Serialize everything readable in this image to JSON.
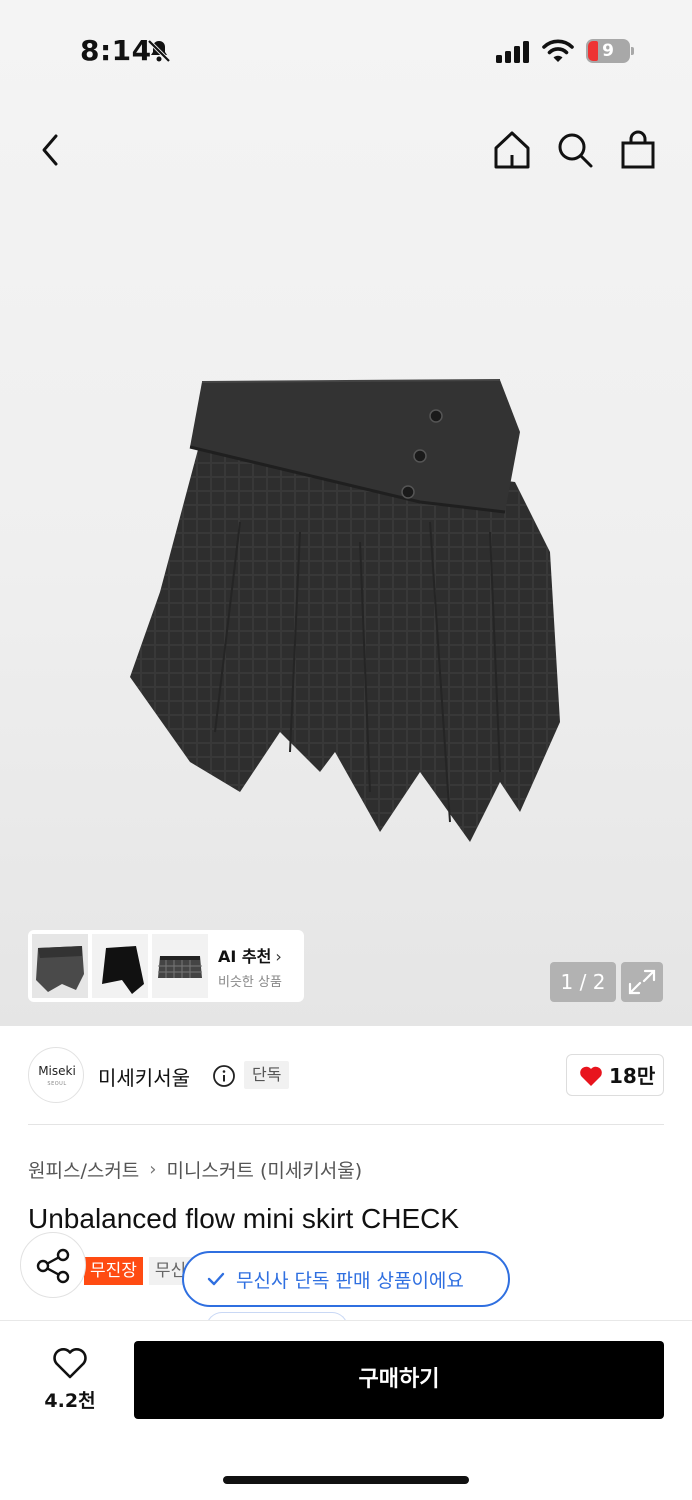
{
  "status": {
    "time": "8:14",
    "battery": "9"
  },
  "gallery": {
    "ai_recommend_title": "AI 추천",
    "ai_recommend_sub": "비슷한 상품",
    "pager": "1 / 2"
  },
  "brand": {
    "logo_text": "Miseki",
    "logo_sub": "SEOUL",
    "name": "미세키서울",
    "exclusive": "단독",
    "likes": "18만"
  },
  "breadcrumb": {
    "category": "원피스/스커트",
    "subcategory": "미니스커트 (미세키서울)"
  },
  "product": {
    "title": "Unbalanced flow mini skirt CHECK",
    "tag_free_shipping": "무진장",
    "tag_partial": "무신"
  },
  "toast": {
    "message": "무신사 단독 판매 상품이에요"
  },
  "bottom": {
    "wish_count": "4.2천",
    "buy_label": "구매하기"
  },
  "colors": {
    "accent_blue": "#2f6fe0",
    "sale_orange": "#ff4b12",
    "heart_red": "#e8141d",
    "buy_black": "#000000"
  }
}
